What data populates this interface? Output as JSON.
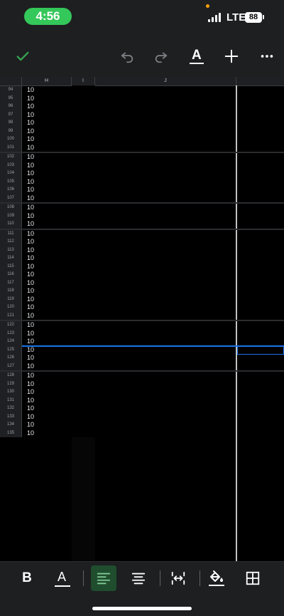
{
  "status": {
    "time": "4:56",
    "network": "LTE",
    "battery": "88"
  },
  "toolbar": {
    "icons": [
      "check-icon",
      "undo-icon",
      "redo-icon",
      "text-format-icon",
      "add-icon",
      "more-icon"
    ],
    "text_format_glyph": "A"
  },
  "sheet": {
    "columns": [
      "H",
      "I",
      "J",
      ""
    ],
    "rows": [
      {
        "n": "94",
        "h": "10",
        "i": "",
        "j": "",
        "k": ""
      },
      {
        "n": "95",
        "h": "10",
        "i": "",
        "j": "",
        "k": ""
      },
      {
        "n": "96",
        "h": "10",
        "i": "",
        "j": "",
        "k": ""
      },
      {
        "n": "97",
        "h": "10",
        "i": "",
        "j": "",
        "k": ""
      },
      {
        "n": "98",
        "h": "10",
        "i": "",
        "j": "",
        "k": ""
      },
      {
        "n": "99",
        "h": "10",
        "i": "",
        "j": "",
        "k": ""
      },
      {
        "n": "100",
        "h": "10",
        "i": "",
        "j": "",
        "k": ""
      },
      {
        "n": "101",
        "h": "10",
        "i": "",
        "j": "",
        "k": ""
      },
      {
        "n": "102",
        "h": "10",
        "i": "",
        "j": "",
        "k": ""
      },
      {
        "n": "103",
        "h": "10",
        "i": "",
        "j": "",
        "k": ""
      },
      {
        "n": "104",
        "h": "10",
        "i": "",
        "j": "",
        "k": ""
      },
      {
        "n": "105",
        "h": "10",
        "i": "",
        "j": "",
        "k": ""
      },
      {
        "n": "106",
        "h": "10",
        "i": "",
        "j": "",
        "k": ""
      },
      {
        "n": "107",
        "h": "10",
        "i": "",
        "j": "",
        "k": ""
      },
      {
        "n": "108",
        "h": "10",
        "i": "",
        "j": "",
        "k": ""
      },
      {
        "n": "109",
        "h": "10",
        "i": "",
        "j": "",
        "k": ""
      },
      {
        "n": "110",
        "h": "10",
        "i": "",
        "j": "",
        "k": ""
      },
      {
        "n": "111",
        "h": "10",
        "i": "",
        "j": "",
        "k": ""
      },
      {
        "n": "112",
        "h": "10",
        "i": "",
        "j": "",
        "k": ""
      },
      {
        "n": "113",
        "h": "10",
        "i": "",
        "j": "",
        "k": ""
      },
      {
        "n": "114",
        "h": "10",
        "i": "",
        "j": "",
        "k": ""
      },
      {
        "n": "115",
        "h": "10",
        "i": "",
        "j": "",
        "k": ""
      },
      {
        "n": "116",
        "h": "10",
        "i": "",
        "j": "",
        "k": ""
      },
      {
        "n": "117",
        "h": "10",
        "i": "",
        "j": "",
        "k": ""
      },
      {
        "n": "118",
        "h": "10",
        "i": "",
        "j": "",
        "k": ""
      },
      {
        "n": "119",
        "h": "10",
        "i": "",
        "j": "",
        "k": ""
      },
      {
        "n": "120",
        "h": "10",
        "i": "",
        "j": "",
        "k": ""
      },
      {
        "n": "121",
        "h": "10",
        "i": "",
        "j": "",
        "k": ""
      },
      {
        "n": "122",
        "h": "10",
        "i": "",
        "j": "",
        "k": ""
      },
      {
        "n": "123",
        "h": "10",
        "i": "",
        "j": "",
        "k": ""
      },
      {
        "n": "124",
        "h": "10",
        "i": "",
        "j": "",
        "k": ""
      },
      {
        "n": "125",
        "h": "10",
        "i": "",
        "j": "",
        "k": ""
      },
      {
        "n": "126",
        "h": "10",
        "i": "",
        "j": "",
        "k": ""
      },
      {
        "n": "127",
        "h": "10",
        "i": "",
        "j": "",
        "k": ""
      },
      {
        "n": "128",
        "h": "10",
        "i": "",
        "j": "",
        "k": ""
      },
      {
        "n": "129",
        "h": "10",
        "i": "",
        "j": "",
        "k": ""
      },
      {
        "n": "130",
        "h": "10",
        "i": "",
        "j": "",
        "k": ""
      },
      {
        "n": "131",
        "h": "10",
        "i": "",
        "j": "",
        "k": ""
      },
      {
        "n": "132",
        "h": "10",
        "i": "",
        "j": "",
        "k": ""
      },
      {
        "n": "133",
        "h": "10",
        "i": "",
        "j": "",
        "k": ""
      },
      {
        "n": "134",
        "h": "10",
        "i": "",
        "j": "",
        "k": ""
      },
      {
        "n": "135",
        "h": "10",
        "i": "",
        "j": "",
        "k": ""
      }
    ],
    "selected_row": "125"
  },
  "format_bar": {
    "icons": [
      "bold-icon",
      "text-color-icon",
      "align-left-icon",
      "align-center-icon",
      "wrap-text-icon",
      "fill-color-icon",
      "borders-icon"
    ],
    "bold_glyph": "B",
    "text_color_glyph": "A",
    "active": "align-left-icon",
    "accent_color": "#34a853"
  },
  "colors": {
    "background": "#1e1f21",
    "selection": "#1a73e8",
    "time_pill": "#34c759"
  }
}
